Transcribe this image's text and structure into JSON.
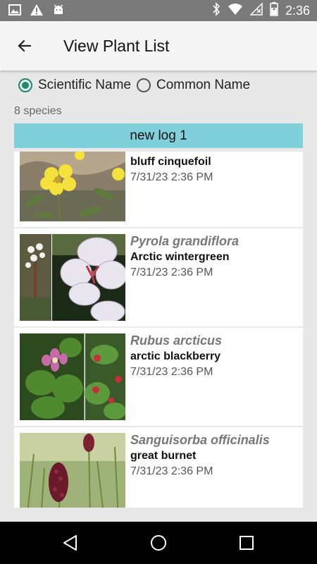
{
  "status_bar": {
    "time": "2:36",
    "left_icons": [
      "image-icon",
      "warning-icon",
      "android-icon"
    ],
    "right_icons": [
      "bluetooth-icon",
      "wifi-icon",
      "signal-icon",
      "battery-icon"
    ]
  },
  "app_bar": {
    "title": "View Plant List",
    "back_icon": "back-arrow-icon"
  },
  "name_mode": {
    "options": [
      {
        "label": "Scientific Name",
        "selected": true
      },
      {
        "label": "Common Name",
        "selected": false
      }
    ]
  },
  "species_count": "8 species",
  "log_name": "new log 1",
  "plants": [
    {
      "scientific": "",
      "common": "bluff cinquefoil",
      "date": "7/31/23 2:36 PM"
    },
    {
      "scientific": "Pyrola grandiflora",
      "common": "Arctic wintergreen",
      "date": "7/31/23 2:36 PM"
    },
    {
      "scientific": "Rubus arcticus",
      "common": "arctic blackberry",
      "date": "7/31/23 2:36 PM"
    },
    {
      "scientific": "Sanguisorba officinalis",
      "common": "great burnet",
      "date": "7/31/23 2:36 PM"
    }
  ],
  "colors": {
    "accent": "#1e8a73",
    "log_header": "#80d0dc",
    "status_bar": "#7a7a7a"
  },
  "nav_bar": {
    "icons": [
      "back-triangle-icon",
      "home-circle-icon",
      "recents-square-icon"
    ]
  }
}
